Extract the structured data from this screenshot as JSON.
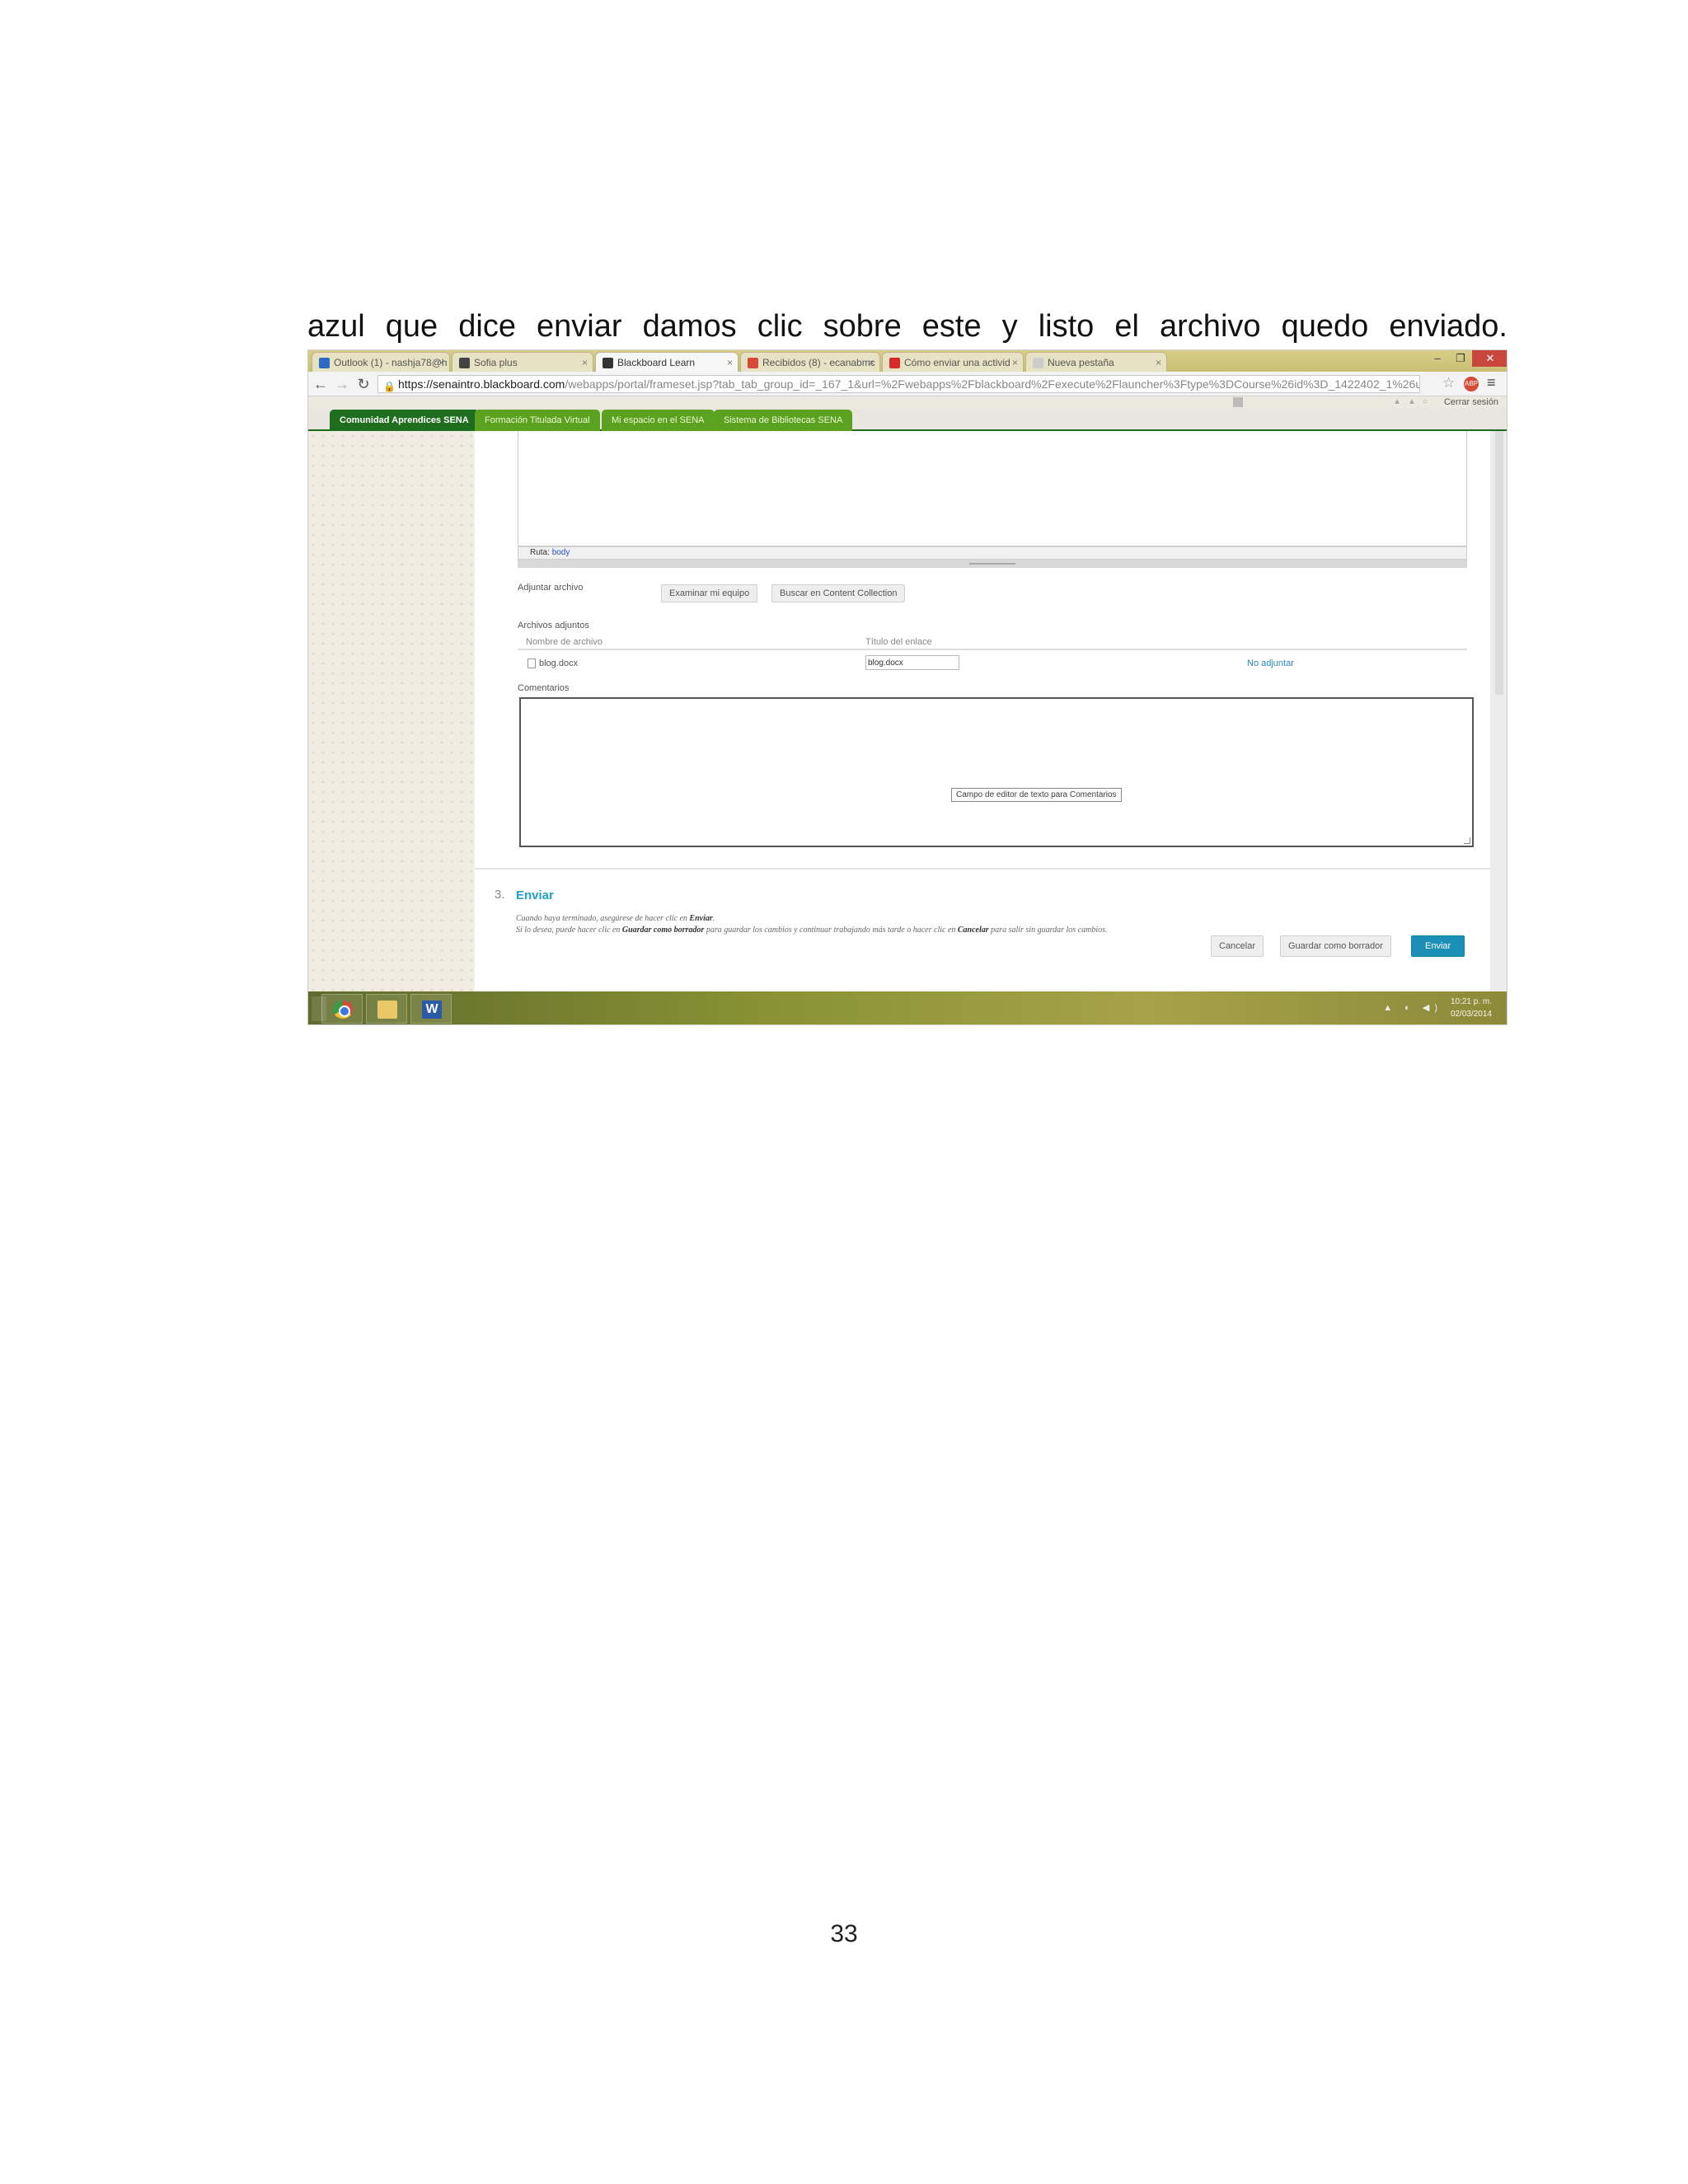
{
  "document": {
    "paragraph_line": "azul que dice enviar damos clic sobre este y listo el archivo quedo enviado.",
    "page_number": "33"
  },
  "browser": {
    "tabs": [
      {
        "label": "Outlook (1) - nashja78@h",
        "favicon_color": "#2b6bc6"
      },
      {
        "label": "Sofia plus",
        "favicon_color": "#444444"
      },
      {
        "label": "Blackboard Learn",
        "favicon_color": "#333333",
        "active": true
      },
      {
        "label": "Recibidos (8) - ecanabmc",
        "favicon_color": "#d64a3a"
      },
      {
        "label": "Cómo enviar una activid",
        "favicon_color": "#d62b2b"
      },
      {
        "label": "Nueva pestaña",
        "favicon_color": "#cccccc"
      }
    ],
    "url_host": "https://senaintro.blackboard.com",
    "url_path": "/webapps/portal/frameset.jsp?tab_tab_group_id=_167_1&url=%2Fwebapps%2Fblackboard%2Fexecute%2Flauncher%3Ftype%3DCourse%26id%3D_1422402_1%26ur",
    "extension_label": "ABP"
  },
  "topbar": {
    "logout": "Cerrar sesión"
  },
  "nav": {
    "tabs": [
      {
        "label": "Comunidad Aprendices SENA",
        "active": true
      },
      {
        "label": "Formación Titulada Virtual"
      },
      {
        "label": "Mi espacio en el SENA"
      },
      {
        "label": "Sistema de Bibliotecas SENA"
      }
    ]
  },
  "editor": {
    "path_label": "Ruta:",
    "path_value": "body"
  },
  "attach": {
    "label": "Adjuntar archivo",
    "browse_button": "Examinar mi equipo",
    "content_button": "Buscar en Content Collection",
    "attached_label": "Archivos adjuntos",
    "col_filename": "Nombre de archivo",
    "col_link_title": "Título del enlace",
    "file_name": "blog.docx",
    "file_title_value": "blog.docx",
    "detach_link": "No adjuntar"
  },
  "comments": {
    "label": "Comentarios",
    "tooltip": "Campo de editor de texto para Comentarios"
  },
  "submit_section": {
    "number": "3.",
    "title": "Enviar",
    "line1_prefix": "Cuando haya terminado, asegúrese de hacer clic en ",
    "line1_bold": "Enviar",
    "line1_suffix": ".",
    "line2_a": "Si lo desea, puede hacer clic en ",
    "line2_bold1": "Guardar como borrador",
    "line2_b": " para guardar los cambios y continuar trabajando más tarde o hacer clic en ",
    "line2_bold2": "Cancelar",
    "line2_c": " para salir sin guardar los cambios.",
    "cancel_button": "Cancelar",
    "draft_button": "Guardar como borrador",
    "submit_button": "Enviar"
  },
  "taskbar": {
    "time": "10:21 p. m.",
    "date": "02/03/2014",
    "word_icon_letter": "W"
  }
}
